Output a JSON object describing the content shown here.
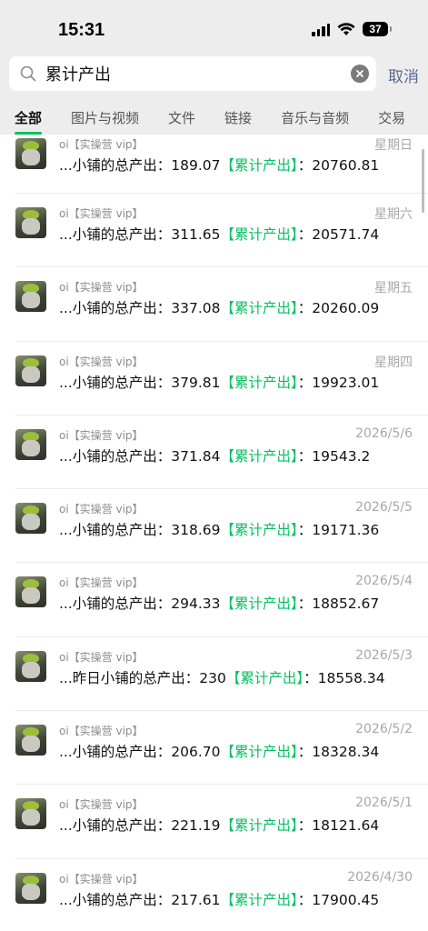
{
  "status": {
    "time": "15:31",
    "battery": "37"
  },
  "search": {
    "query": "累计产出",
    "cancel": "取消"
  },
  "tabs": [
    {
      "label": "全部",
      "active": true
    },
    {
      "label": "图片与视频",
      "active": false
    },
    {
      "label": "文件",
      "active": false
    },
    {
      "label": "链接",
      "active": false
    },
    {
      "label": "音乐与音频",
      "active": false
    },
    {
      "label": "交易",
      "active": false
    }
  ],
  "results": [
    {
      "sender": "oi【实操营 vip】",
      "date": "星期日",
      "prefix": "...小铺的总产出：189.07",
      "keyword": "【累计产出】",
      "suffix": "：20760.81"
    },
    {
      "sender": "oi【实操营 vip】",
      "date": "星期六",
      "prefix": "...小铺的总产出：311.65",
      "keyword": "【累计产出】",
      "suffix": "：20571.74"
    },
    {
      "sender": "oi【实操营 vip】",
      "date": "星期五",
      "prefix": "...小铺的总产出：337.08",
      "keyword": "【累计产出】",
      "suffix": "：20260.09"
    },
    {
      "sender": "oi【实操营 vip】",
      "date": "星期四",
      "prefix": "...小铺的总产出：379.81",
      "keyword": "【累计产出】",
      "suffix": "：19923.01"
    },
    {
      "sender": "oi【实操营 vip】",
      "date": "2026/5/6",
      "prefix": "...小铺的总产出：371.84",
      "keyword": "【累计产出】",
      "suffix": "：19543.2"
    },
    {
      "sender": "oi【实操营 vip】",
      "date": "2026/5/5",
      "prefix": "...小铺的总产出：318.69",
      "keyword": "【累计产出】",
      "suffix": "：19171.36"
    },
    {
      "sender": "oi【实操营 vip】",
      "date": "2026/5/4",
      "prefix": "...小铺的总产出：294.33",
      "keyword": "【累计产出】",
      "suffix": "：18852.67"
    },
    {
      "sender": "oi【实操营 vip】",
      "date": "2026/5/3",
      "prefix": "...昨日小铺的总产出：230",
      "keyword": "【累计产出】",
      "suffix": "：18558.34"
    },
    {
      "sender": "oi【实操营 vip】",
      "date": "2026/5/2",
      "prefix": "...小铺的总产出：206.70",
      "keyword": "【累计产出】",
      "suffix": "：18328.34"
    },
    {
      "sender": "oi【实操营 vip】",
      "date": "2026/5/1",
      "prefix": "...小铺的总产出：221.19",
      "keyword": "【累计产出】",
      "suffix": "：18121.64"
    },
    {
      "sender": "oi【实操营 vip】",
      "date": "2026/4/30",
      "prefix": "...小铺的总产出：217.61",
      "keyword": "【累计产出】",
      "suffix": "：17900.45"
    }
  ],
  "colors": {
    "accent": "#07c160",
    "link": "#576b95",
    "background": "#ededed"
  }
}
